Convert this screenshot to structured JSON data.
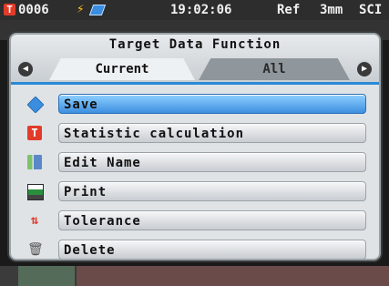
{
  "status": {
    "sample_id": "0006",
    "time": "19:02:06",
    "ref": "Ref",
    "aperture": "3mm",
    "mode": "SCI"
  },
  "dialog": {
    "title": "Target Data Function",
    "tabs": [
      {
        "label": "Current",
        "active": true
      },
      {
        "label": "All",
        "active": false
      }
    ],
    "prev_arrow": "◀",
    "next_arrow": "▶"
  },
  "menu": {
    "items": [
      {
        "label": "Save",
        "icon": "tag-icon",
        "selected": true
      },
      {
        "label": "Statistic calculation",
        "icon": "t-icon"
      },
      {
        "label": "Edit Name",
        "icon": "edit-name-icon"
      },
      {
        "label": "Print",
        "icon": "printer-icon"
      },
      {
        "label": "Tolerance",
        "icon": "tolerance-icon"
      },
      {
        "label": "Delete",
        "icon": "trash-icon"
      }
    ]
  },
  "colors": {
    "accent": "#2a8ad6",
    "selected_item": "#3d8fe0",
    "t_icon": "#e23b2a"
  }
}
